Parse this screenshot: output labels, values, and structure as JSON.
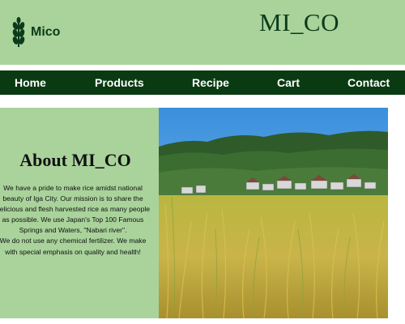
{
  "header": {
    "logo_text": "Mico",
    "site_title": "MI_CO"
  },
  "nav": {
    "items": [
      {
        "label": "Home"
      },
      {
        "label": "Products"
      },
      {
        "label": "Recipe"
      },
      {
        "label": "Cart"
      },
      {
        "label": "Contact"
      }
    ]
  },
  "about": {
    "title": "About MI_CO",
    "paragraphs": [
      "We have a pride to make rice amidst national beauty of Iga City. Our mission is to share the delicious and flesh harvested rice as many people as possible. We use Japan's Top 100 Famous Springs and Waters, \"Nabari river\".",
      "We do not use any chemical fertilizer. We make with special emphasis on quality and health!"
    ]
  },
  "colors": {
    "header_bg": "#a9d39b",
    "nav_bg": "#0a3a12",
    "brand_dark": "#0c3b1a"
  },
  "icons": {
    "logo": "rice-plant-icon"
  }
}
